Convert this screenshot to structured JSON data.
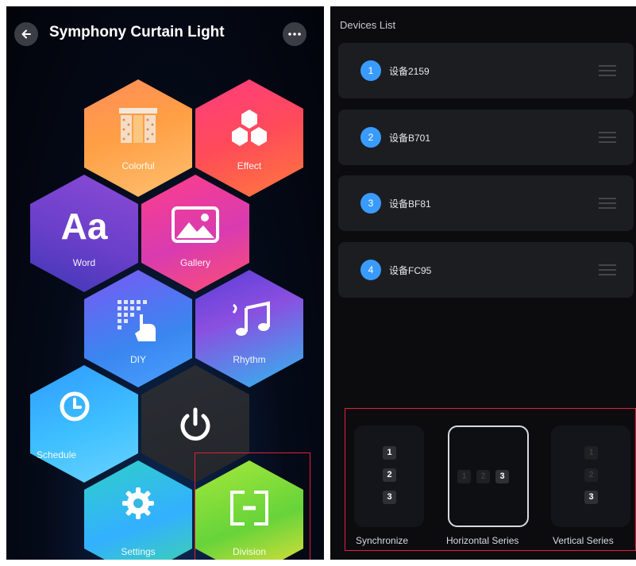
{
  "app": {
    "title": "Symphony Curtain Light"
  },
  "tiles": {
    "colorful": "Colorful",
    "effect": "Effect",
    "word": "Word",
    "word_glyph": "Aa",
    "gallery": "Gallery",
    "diy": "DIY",
    "rhythm": "Rhythm",
    "schedule": "Schedule",
    "settings": "Settings",
    "division": "Division"
  },
  "devices": {
    "title": "Devices List",
    "items": [
      {
        "num": "1",
        "name": "设备2159"
      },
      {
        "num": "2",
        "name": "设备B701"
      },
      {
        "num": "3",
        "name": "设备BF81"
      },
      {
        "num": "4",
        "name": "设备FC95"
      }
    ]
  },
  "modes": {
    "items": [
      {
        "label": "Synchronize",
        "cells": [
          "1",
          "2",
          "3"
        ]
      },
      {
        "label": "Horizontal Series",
        "cells": [
          "1",
          "2",
          "3"
        ]
      },
      {
        "label": "Vertical Series",
        "cells": [
          "1",
          "2",
          "3"
        ]
      }
    ],
    "selected": "Horizontal Series"
  },
  "colors": {
    "accent_blue": "#3a9bff",
    "highlight_red": "#e0203a",
    "panel_bg": "#1c1d21"
  }
}
